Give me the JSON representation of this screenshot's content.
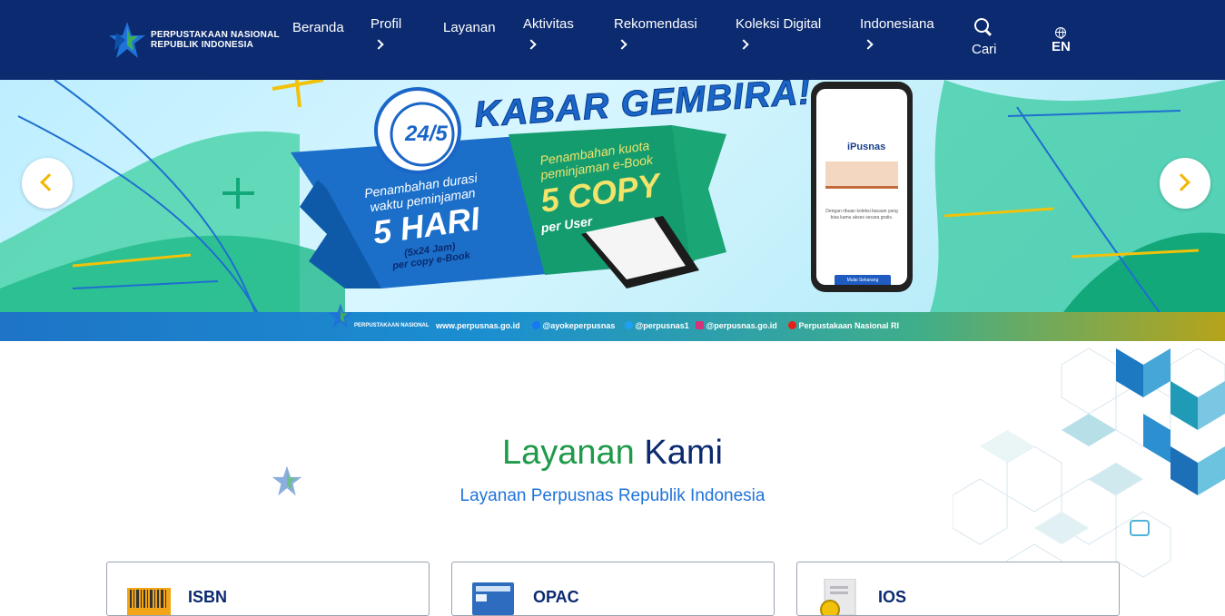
{
  "header": {
    "logo_line1": "PERPUSTAKAAN NASIONAL",
    "logo_line2": "REPUBLIK INDONESIA",
    "nav": [
      {
        "label": "Beranda",
        "has_submenu": false
      },
      {
        "label": "Profil",
        "has_submenu": true
      },
      {
        "label": "Layanan",
        "has_submenu": false
      },
      {
        "label": "Aktivitas",
        "has_submenu": true
      },
      {
        "label": "Rekomendasi",
        "has_submenu": true
      },
      {
        "label": "Koleksi Digital",
        "has_submenu": true
      },
      {
        "label": "Indonesiana",
        "has_submenu": true
      }
    ],
    "search_label": "Cari",
    "lang_label": "EN"
  },
  "banner": {
    "headline": "KABAR GEMBIRA!",
    "badge": "24/5",
    "left_ribbon_line1": "Penambahan durasi",
    "left_ribbon_line2": "waktu peminjaman",
    "left_ribbon_big": "5 HARI",
    "left_ribbon_small1": "(5x24 Jam)",
    "left_ribbon_small2": "per copy e-Book",
    "right_ribbon_line1": "Penambahan kuota",
    "right_ribbon_line2": "peminjaman e-Book",
    "right_ribbon_big": "5 COPY",
    "right_ribbon_small": "per User",
    "phone_app": "iPusnas",
    "phone_desc": "Dengan ribuan koleksi bacaan yang bisa kamu akses secara gratis.",
    "phone_cta": "Mulai Sekarang",
    "footer": {
      "org": "PERPUSTAKAAN NASIONAL",
      "website": "www.perpusnas.go.id",
      "facebook": "@ayokeperpusnas",
      "twitter": "@perpusnas1",
      "instagram": "@perpusnas.go.id",
      "youtube": "Perpustakaan Nasional RI"
    }
  },
  "services": {
    "title_green": "Layanan",
    "title_navy": "Kami",
    "subtitle": "Layanan Perpusnas Republik Indonesia",
    "cards": [
      {
        "label": "ISBN"
      },
      {
        "label": "OPAC"
      },
      {
        "label": "IOS"
      }
    ]
  },
  "colors": {
    "nav_bg": "#0b2a6f",
    "accent_green": "#1f9a4a",
    "accent_blue": "#1f73d8",
    "carousel_arrow": "#f2b705"
  }
}
